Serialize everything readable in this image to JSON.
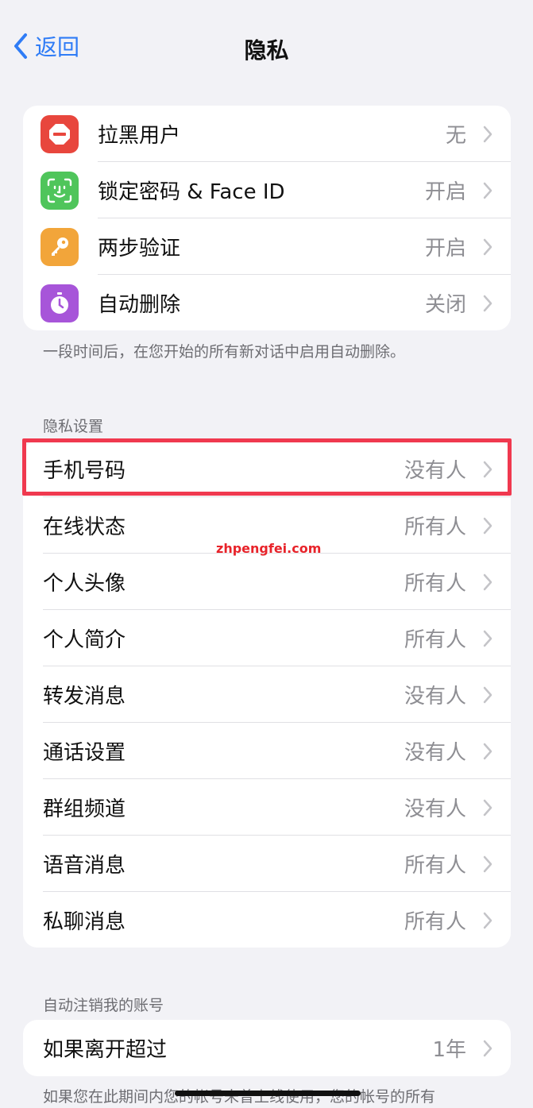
{
  "nav": {
    "back_label": "返回",
    "title": "隐私"
  },
  "group1": {
    "items": [
      {
        "label": "拉黑用户",
        "value": "无",
        "icon": "block-icon",
        "color": "#e8463d"
      },
      {
        "label": "锁定密码 & Face ID",
        "value": "开启",
        "icon": "face-id-icon",
        "color": "#4fc55b"
      },
      {
        "label": "两步验证",
        "value": "开启",
        "icon": "key-icon",
        "color": "#f2a53a"
      },
      {
        "label": "自动删除",
        "value": "关闭",
        "icon": "timer-icon",
        "color": "#a755d9"
      }
    ],
    "footnote": "一段时间后，在您开始的所有新对话中启用自动删除。"
  },
  "privacy_settings": {
    "header": "隐私设置",
    "items": [
      {
        "label": "手机号码",
        "value": "没有人"
      },
      {
        "label": "在线状态",
        "value": "所有人"
      },
      {
        "label": "个人头像",
        "value": "所有人"
      },
      {
        "label": "个人简介",
        "value": "所有人"
      },
      {
        "label": "转发消息",
        "value": "没有人"
      },
      {
        "label": "通话设置",
        "value": "没有人"
      },
      {
        "label": "群组频道",
        "value": "没有人"
      },
      {
        "label": "语音消息",
        "value": "所有人"
      },
      {
        "label": "私聊消息",
        "value": "所有人"
      }
    ]
  },
  "auto_delete_account": {
    "header": "自动注销我的账号",
    "label": "如果离开超过",
    "value": "1年",
    "footnote": "如果您在此期间内您的帐号未曾上线使用，您的帐号的所有"
  },
  "watermark": "zhpengfei.com",
  "colors": {
    "accent": "#2f7cf6",
    "highlight": "#f0394f",
    "background": "#f2f2f6"
  }
}
